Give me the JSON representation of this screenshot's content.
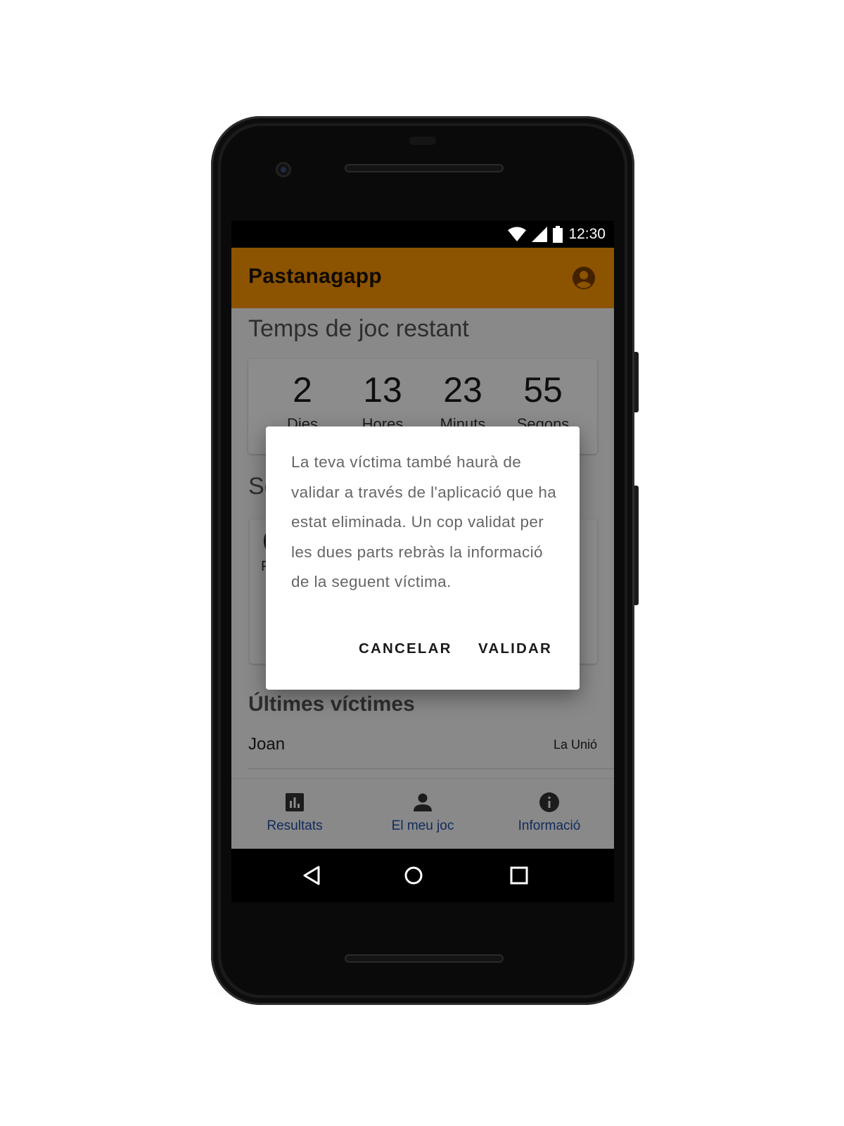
{
  "status_bar": {
    "time": "12:30",
    "icons": [
      "wifi-icon",
      "signal-icon",
      "battery-icon"
    ]
  },
  "app_bar": {
    "title": "Pastanagapp",
    "action_icon": "account-circle-icon",
    "background_color": "#ff9800"
  },
  "countdown": {
    "section_title": "Temps de joc restant",
    "items": [
      {
        "value": "2",
        "label": "Dies"
      },
      {
        "value": "13",
        "label": "Hores"
      },
      {
        "value": "23",
        "label": "Minuts"
      },
      {
        "value": "55",
        "label": "Segons"
      }
    ]
  },
  "second_section": {
    "title_partial": "Se",
    "card_line1_partial": "(",
    "card_line2_partial": "F"
  },
  "victims": {
    "section_title": "Últimes víctimes",
    "rows": [
      {
        "name": "Joan",
        "place": "La Unió"
      }
    ]
  },
  "bottom_nav": {
    "items": [
      {
        "label": "Resultats",
        "icon": "bar-chart-icon"
      },
      {
        "label": "El meu joc",
        "icon": "person-icon"
      },
      {
        "label": "Informació",
        "icon": "info-icon"
      }
    ],
    "label_color": "#1f4fa8"
  },
  "dialog": {
    "message": "La teva víctima també haurà de validar a través de l'aplicació que ha estat eliminada. Un cop validat per les dues parts rebràs la informació de la seguent víctima.",
    "cancel_label": "CANCELAR",
    "confirm_label": "VALIDAR"
  },
  "system_nav": {
    "icons": [
      "back-triangle-icon",
      "home-circle-icon",
      "recents-square-icon"
    ]
  }
}
